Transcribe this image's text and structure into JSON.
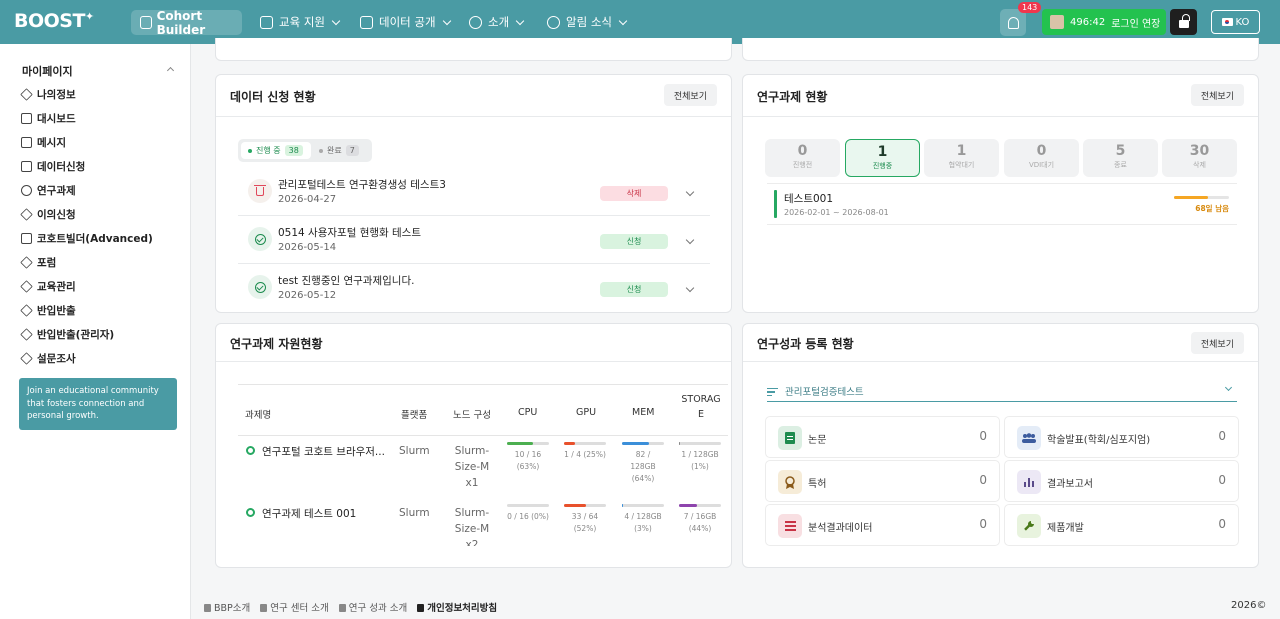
{
  "header": {
    "logo": "BOOST",
    "nav": [
      {
        "label": "Cohort Builder"
      },
      {
        "label": "교육 지원"
      },
      {
        "label": "데이터 공개"
      },
      {
        "label": "소개"
      },
      {
        "label": "알림 소식"
      }
    ],
    "notification_count": "143",
    "session_timer": "496:42",
    "session_extend": "로그인 연장",
    "language": "KO"
  },
  "sidebar": {
    "title": "마이페이지",
    "items": [
      {
        "label": "나의정보"
      },
      {
        "label": "대시보드"
      },
      {
        "label": "메시지"
      },
      {
        "label": "데이터신청"
      },
      {
        "label": "연구과제"
      },
      {
        "label": "이의신청"
      },
      {
        "label": "코호트빌더(Advanced)"
      },
      {
        "label": "포럼"
      },
      {
        "label": "교육관리"
      },
      {
        "label": "반입반출"
      },
      {
        "label": "반입반출(관리자)"
      },
      {
        "label": "설문조사"
      }
    ],
    "promo": "Join an educational community that fosters connection and personal growth."
  },
  "data_app": {
    "title": "데이터 신청 현황",
    "view_all": "전체보기",
    "tabs": [
      {
        "label": "진행 중",
        "count": "38"
      },
      {
        "label": "완료",
        "count": "7"
      }
    ],
    "rows": [
      {
        "title": "관리포털테스트 연구환경생성 테스트3",
        "date": "2026-04-27",
        "status": "삭제"
      },
      {
        "title": "0514 사용자포털 현행화 테스트",
        "date": "2026-05-14",
        "status": "신청"
      },
      {
        "title": "test 진행중인 연구과제입니다.",
        "date": "2026-05-12",
        "status": "신청"
      }
    ]
  },
  "research": {
    "title": "연구과제 현황",
    "view_all": "전체보기",
    "stats": [
      {
        "num": "0",
        "label": "진행전"
      },
      {
        "num": "1",
        "label": "진행중"
      },
      {
        "num": "1",
        "label": "협약대기"
      },
      {
        "num": "0",
        "label": "VDI대기"
      },
      {
        "num": "5",
        "label": "종료"
      },
      {
        "num": "30",
        "label": "삭제"
      }
    ],
    "project": {
      "name": "테스트001",
      "period": "2026-02-01 ~ 2026-08-01",
      "remaining": "68일 남음",
      "progress": 0.62
    }
  },
  "resources": {
    "title": "연구과제 자원현황",
    "headers": [
      "과제명",
      "플랫폼",
      "노드 구성",
      "CPU",
      "GPU",
      "MEM",
      "STORAG",
      "E"
    ],
    "rows": [
      {
        "name": "연구포털 코호트 브라우저...",
        "platform": "Slurm",
        "node_lines": [
          "Slurm-",
          "Size-M",
          "x1"
        ],
        "cpu": {
          "text1": "10 / 16",
          "text2": "(63%)",
          "pct": 0.63,
          "color": "#4caf50"
        },
        "gpu": {
          "text1": "1 / 4 (25%)",
          "text2": "",
          "pct": 0.25,
          "color": "#e8512c"
        },
        "mem": {
          "text1": "82 / 128GB",
          "text2": "(64%)",
          "pct": 0.64,
          "color": "#3b8fd9"
        },
        "sto": {
          "text1": "1 / 128GB",
          "text2": "(1%)",
          "pct": 0.01,
          "color": "#888888"
        }
      },
      {
        "name": "연구과제 테스트 001",
        "platform": "Slurm",
        "node_lines": [
          "Slurm-",
          "Size-M",
          "x2"
        ],
        "cpu": {
          "text1": "0 / 16 (0%)",
          "text2": "",
          "pct": 0.0,
          "color": "#4caf50"
        },
        "gpu": {
          "text1": "33 / 64",
          "text2": "(52%)",
          "pct": 0.52,
          "color": "#e8512c"
        },
        "mem": {
          "text1": "4 / 128GB",
          "text2": "(3%)",
          "pct": 0.03,
          "color": "#3b8fd9"
        },
        "sto": {
          "text1": "7 / 16GB",
          "text2": "(44%)",
          "pct": 0.44,
          "color": "#8e44ad"
        }
      }
    ]
  },
  "performance": {
    "title": "연구성과 등록 현황",
    "view_all": "전체보기",
    "selected": "관리포털검증테스트",
    "items": [
      {
        "label": "논문",
        "value": "0"
      },
      {
        "label": "학술발표(학회/심포지엄)",
        "value": "0"
      },
      {
        "label": "특허",
        "value": "0"
      },
      {
        "label": "결과보고서",
        "value": "0"
      },
      {
        "label": "분석결과데이터",
        "value": "0"
      },
      {
        "label": "제품개발",
        "value": "0"
      }
    ]
  },
  "footer": {
    "links": [
      "BBP소개",
      "연구 센터 소개",
      "연구 성과 소개",
      "개인정보처리방침"
    ],
    "copyright": "2026©"
  }
}
